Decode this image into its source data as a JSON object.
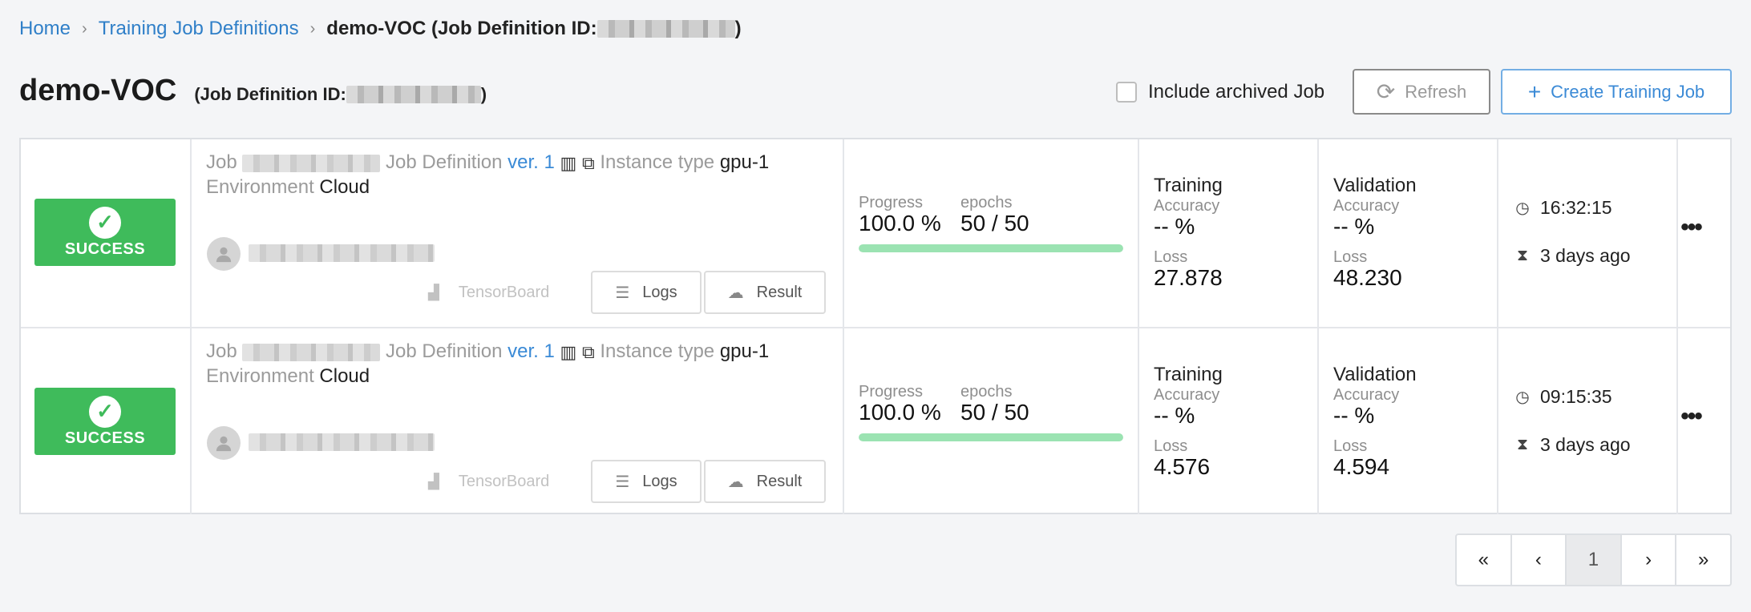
{
  "breadcrumb": {
    "home": "Home",
    "definitions": "Training Job Definitions",
    "current": "demo-VOC (Job Definition ID: ",
    "current_suffix": ")"
  },
  "header": {
    "title": "demo-VOC",
    "id_label": "(Job Definition ID: ",
    "id_suffix": ")"
  },
  "toolbar": {
    "archive_label": "Include archived Job",
    "archive_checked": false,
    "refresh_label": "Refresh",
    "create_label": "Create Training Job"
  },
  "labels": {
    "job": "Job",
    "job_definition": "Job Definition",
    "instance_type": "Instance type",
    "environment": "Environment",
    "tensorboard": "TensorBoard",
    "logs": "Logs",
    "result": "Result",
    "progress": "Progress",
    "epochs": "epochs",
    "training": "Training",
    "validation": "Validation",
    "accuracy": "Accuracy",
    "loss": "Loss"
  },
  "jobs": [
    {
      "status": "SUCCESS",
      "version": "ver. 1",
      "instance_type": "gpu-1",
      "environment": "Cloud",
      "progress": "100.0 %",
      "progress_fraction": 1.0,
      "epochs": "50 / 50",
      "training_accuracy": "-- %",
      "training_loss": "27.878",
      "validation_accuracy": "-- %",
      "validation_loss": "48.230",
      "time": "16:32:15",
      "age": "3 days ago"
    },
    {
      "status": "SUCCESS",
      "version": "ver. 1",
      "instance_type": "gpu-1",
      "environment": "Cloud",
      "progress": "100.0 %",
      "progress_fraction": 1.0,
      "epochs": "50 / 50",
      "training_accuracy": "-- %",
      "training_loss": "4.576",
      "validation_accuracy": "-- %",
      "validation_loss": "4.594",
      "time": "09:15:35",
      "age": "3 days ago"
    }
  ],
  "pagination": {
    "first": "«",
    "prev": "‹",
    "current": "1",
    "next": "›",
    "last": "»"
  },
  "icons": {
    "refresh": "refresh-icon",
    "create": "plus-icon",
    "check": "check-circle-icon",
    "columns": "columns-icon",
    "copy": "copy-icon",
    "user": "user-icon",
    "tensorboard": "chart-icon",
    "logs": "list-icon",
    "result": "cloud-download-icon",
    "clock": "clock-icon",
    "hourglass": "hourglass-icon",
    "more": "more-icon"
  },
  "colors": {
    "link": "#2f7fc8",
    "success": "#3fbb5b",
    "progress_bar": "#9be3b2"
  }
}
